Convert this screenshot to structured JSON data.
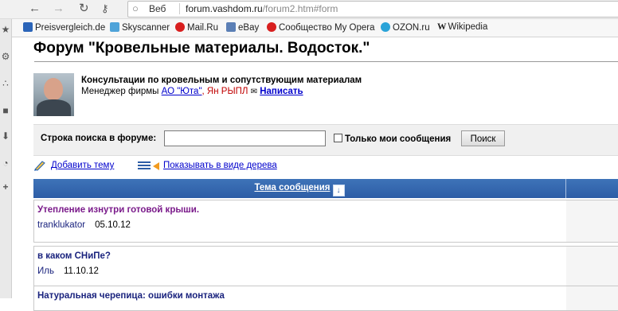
{
  "browser": {
    "web_label": "Веб",
    "url_domain": "forum.vashdom.ru",
    "url_path": "/forum2.htm#form"
  },
  "bookmarks": [
    {
      "label": "Preisvergleich.de",
      "color": "#2b64b8"
    },
    {
      "label": "Skyscanner",
      "color": "#4fa3d9"
    },
    {
      "label": "Mail.Ru",
      "color": "#d81f1f"
    },
    {
      "label": "eBay",
      "color": "#5b7fb5"
    },
    {
      "label": "Сообщество My Opera",
      "color": "#d81f1f"
    },
    {
      "label": "OZON.ru",
      "color": "#2aa3d8"
    },
    {
      "label": "Wikipedia",
      "color": "#333333"
    }
  ],
  "page": {
    "title": "Форум \"Кровельные материалы. Водосток.\"",
    "consult_title": "Консультации по кровельным и сопутствующим материалам",
    "manager_prefix": "Менеджер фирмы",
    "company_link": "АО \"Юта\"",
    "manager_name": ", Ян РЫПЛ",
    "write_link": "Написать"
  },
  "search": {
    "label": "Строка поиска в форуме:",
    "value": "",
    "only_mine_label": "Только мои сообщения",
    "button": "Поиск"
  },
  "actions": {
    "add_topic": "Добавить тему",
    "tree_view": "Показывать в виде дерева"
  },
  "table": {
    "header": "Тема сообщения",
    "rows": [
      {
        "topic": "Утепление изнутри готовой крыши.",
        "author": "tranklukator",
        "date": "05.10.12"
      },
      {
        "topic": "в каком СНиПе?",
        "author": "Иль",
        "date": "11.10.12"
      },
      {
        "topic": "Натуральная черепица: ошибки монтажа",
        "author": "",
        "date": ""
      }
    ]
  },
  "colors": {
    "header_blue": "#2d5da6",
    "visited_topic": "#7a1a8a",
    "topic_blue": "#1a237e",
    "link_blue": "#0000cc"
  }
}
